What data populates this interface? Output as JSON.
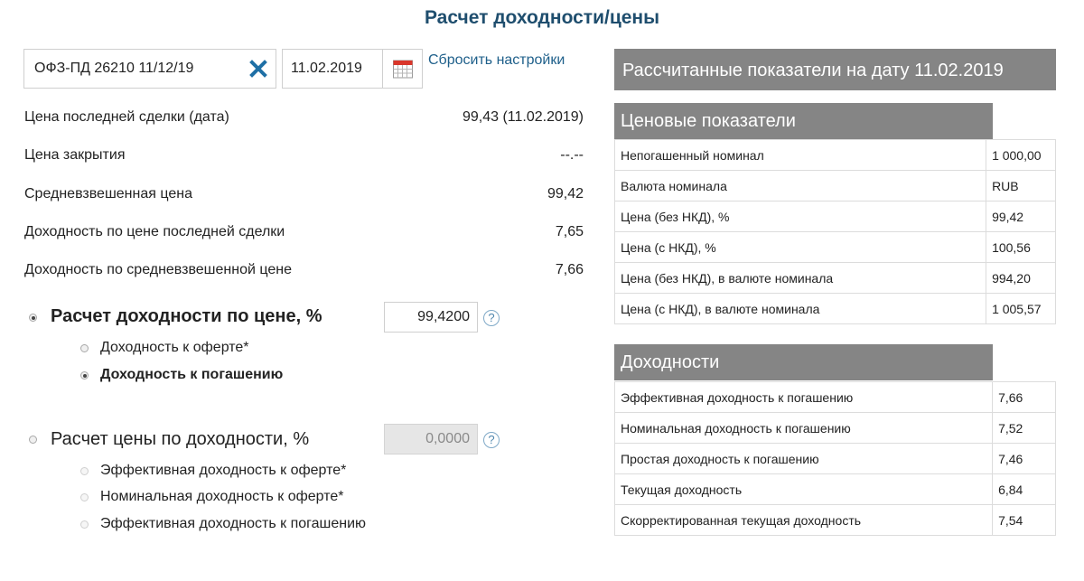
{
  "page": {
    "title": "Расчет доходности/цены"
  },
  "controls": {
    "security": "ОФЗ-ПД 26210 11/12/19",
    "date": "11.02.2019",
    "reset_label": "Сбросить настройки"
  },
  "info": [
    {
      "label": "Цена последней сделки (дата)",
      "value": "99,43 (11.02.2019)"
    },
    {
      "label": "Цена закрытия",
      "value": "--.--"
    },
    {
      "label": "Средневзвешенная цена",
      "value": "99,42"
    },
    {
      "label": "Доходность по цене последней сделки",
      "value": "7,65"
    },
    {
      "label": "Доходность по средневзвешенной цене",
      "value": "7,66"
    }
  ],
  "calc_by_price": {
    "label": "Расчет доходности по цене, %",
    "input_value": "99,4200",
    "selected": true,
    "options": [
      {
        "label": "Доходность к оферте*",
        "checked": false
      },
      {
        "label": "Доходность к погашению",
        "checked": true
      }
    ]
  },
  "calc_by_yield": {
    "label": "Расчет цены по доходности, %",
    "input_value": "0,0000",
    "selected": false,
    "options": [
      {
        "label": "Эффективная доходность к оферте*",
        "checked": false
      },
      {
        "label": "Номинальная доходность к оферте*",
        "checked": false
      },
      {
        "label": "Эффективная доходность к погашению",
        "checked": false
      }
    ]
  },
  "results": {
    "header": "Рассчитанные показатели на дату 11.02.2019",
    "price_section": {
      "title": "Ценовые показатели",
      "rows": [
        {
          "label": "Непогашенный номинал",
          "value": "1 000,00"
        },
        {
          "label": "Валюта номинала",
          "value": "RUB"
        },
        {
          "label": "Цена (без НКД), %",
          "value": "99,42"
        },
        {
          "label": "Цена (с НКД), %",
          "value": "100,56"
        },
        {
          "label": "Цена (без НКД), в валюте номинала",
          "value": "994,20"
        },
        {
          "label": "Цена (с НКД), в валюте номинала",
          "value": "1 005,57"
        }
      ]
    },
    "yield_section": {
      "title": "Доходности",
      "rows": [
        {
          "label": "Эффективная доходность к погашению",
          "value": "7,66"
        },
        {
          "label": "Номинальная доходность к погашению",
          "value": "7,52"
        },
        {
          "label": "Простая доходность к погашению",
          "value": "7,46"
        },
        {
          "label": "Текущая доходность",
          "value": "6,84"
        },
        {
          "label": "Скорректированная текущая доходность",
          "value": "7,54"
        }
      ]
    }
  },
  "colors": {
    "title": "#1f4e6e",
    "link": "#1e5f8a",
    "header_bg": "#858585",
    "clear_icon": "#1e6fa5"
  },
  "icons": {
    "clear": "close-x-icon",
    "calendar": "calendar-icon",
    "help": "help-icon"
  }
}
